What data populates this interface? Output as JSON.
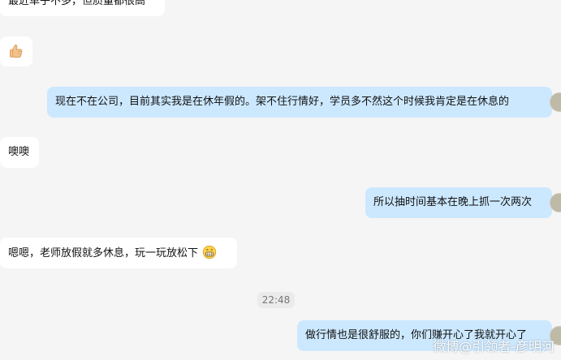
{
  "messages": [
    {
      "side": "left",
      "text": "最近单子不多，但质量都很高"
    },
    {
      "side": "left",
      "emoji": "thumbs-up-icon"
    },
    {
      "side": "right",
      "text": "现在不在公司，目前其实我是在休年假的。架不住行情好，学员多不然这个时候我肯定是在休息的"
    },
    {
      "side": "left",
      "text": "噢噢"
    },
    {
      "side": "right",
      "text": "所以抽时间基本在晚上抓一次两次"
    },
    {
      "side": "left",
      "text": "嗯嗯，老师放假就多休息，玩一玩放松下",
      "emoji": "grinning-face-icon"
    },
    {
      "side": "right",
      "text": "做行情也是很舒服的，你们赚开心了我就开心了"
    }
  ],
  "timestamp": "22:48",
  "watermark": "微博@引领者-彦明河",
  "colors": {
    "background": "#f5f5f5",
    "incoming_bubble": "#ffffff",
    "outgoing_bubble": "#cce8ff",
    "text": "#111111"
  }
}
